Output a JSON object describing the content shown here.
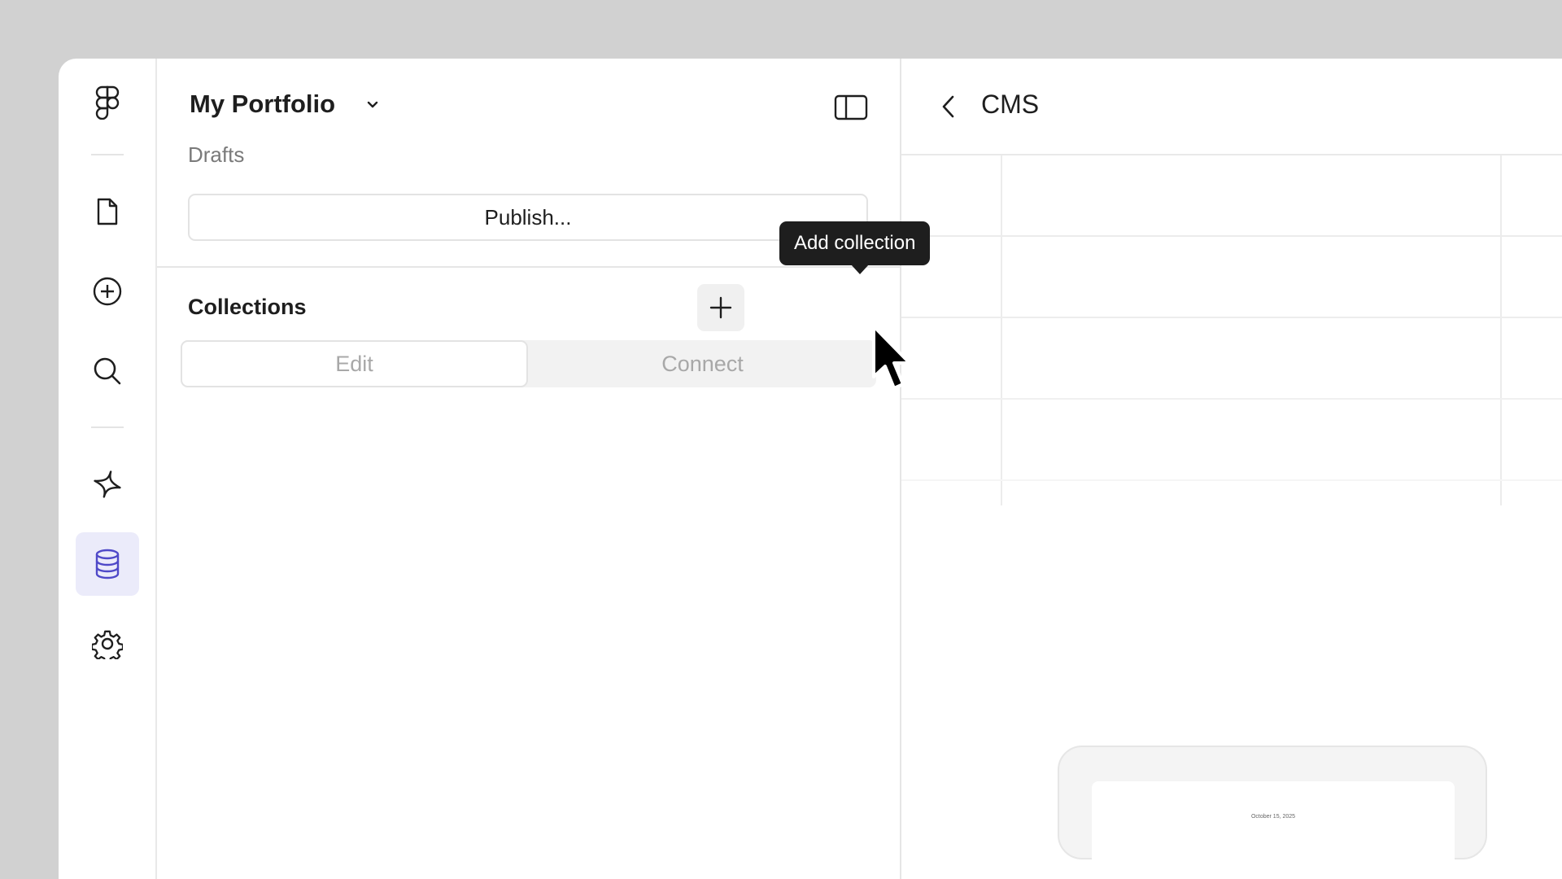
{
  "app": {
    "project_name": "My Portfolio",
    "status": "Drafts",
    "publish_label": "Publish...",
    "accent_color": "#4f49c8"
  },
  "rail": {
    "items": [
      {
        "icon": "figma-logo-icon"
      },
      {
        "icon": "file-icon"
      },
      {
        "icon": "plus-circle-icon"
      },
      {
        "icon": "search-icon"
      },
      {
        "icon": "ai-sparkle-icon"
      },
      {
        "icon": "database-icon",
        "active": true
      },
      {
        "icon": "gear-icon"
      }
    ]
  },
  "collections": {
    "title": "Collections",
    "add_tooltip": "Add collection",
    "tabs": [
      {
        "label": "Edit",
        "selected": true
      },
      {
        "label": "Connect",
        "selected": false
      }
    ]
  },
  "main": {
    "title": "CMS"
  },
  "preview": {
    "date_text": "October 15, 2025"
  }
}
